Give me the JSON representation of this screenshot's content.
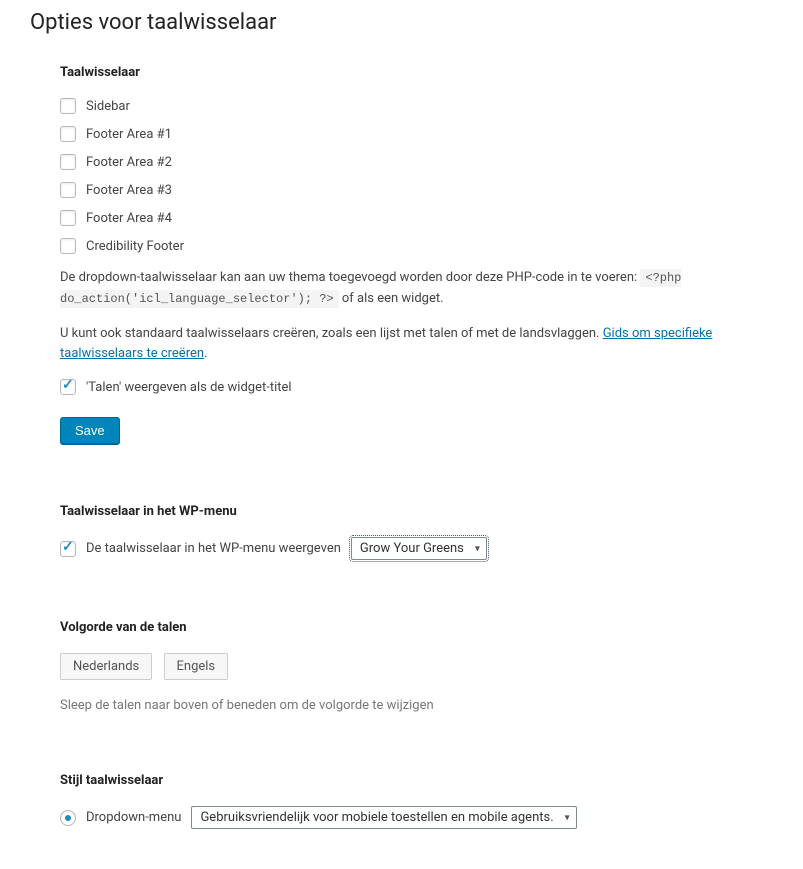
{
  "page": {
    "title": "Opties voor taalwisselaar"
  },
  "switcher": {
    "title": "Taalwisselaar",
    "areas": [
      {
        "label": "Sidebar",
        "checked": false
      },
      {
        "label": "Footer Area #1",
        "checked": false
      },
      {
        "label": "Footer Area #2",
        "checked": false
      },
      {
        "label": "Footer Area #3",
        "checked": false
      },
      {
        "label": "Footer Area #4",
        "checked": false
      },
      {
        "label": "Credibility Footer",
        "checked": false
      }
    ],
    "desc_before": "De dropdown-taalwisselaar kan aan uw thema toegevoegd worden door deze PHP-code in te voeren: ",
    "code": "<?php do_action('icl_language_selector'); ?>",
    "desc_after": " of als een widget.",
    "desc2": "U kunt ook standaard taalwisselaars creëren, zoals een lijst met talen of met de landsvlaggen. ",
    "guide_link": "Gids om specifieke taalwisselaars te creëren",
    "show_lang_widget_title": "'Talen' weergeven als de widget-titel",
    "save_label": "Save"
  },
  "wpmenu": {
    "title": "Taalwisselaar in het WP-menu",
    "checkbox_label": "De taalwisselaar in het WP-menu weergeven",
    "selected_menu": "Grow Your Greens"
  },
  "order": {
    "title": "Volgorde van de talen",
    "languages": [
      "Nederlands",
      "Engels"
    ],
    "hint": "Sleep de talen naar boven of beneden om de volgorde te wijzigen"
  },
  "style": {
    "title": "Stijl taalwisselaar",
    "radio_label": "Dropdown-menu",
    "selected_option": "Gebruiksvriendelijk voor mobiele toestellen en mobile agents."
  }
}
